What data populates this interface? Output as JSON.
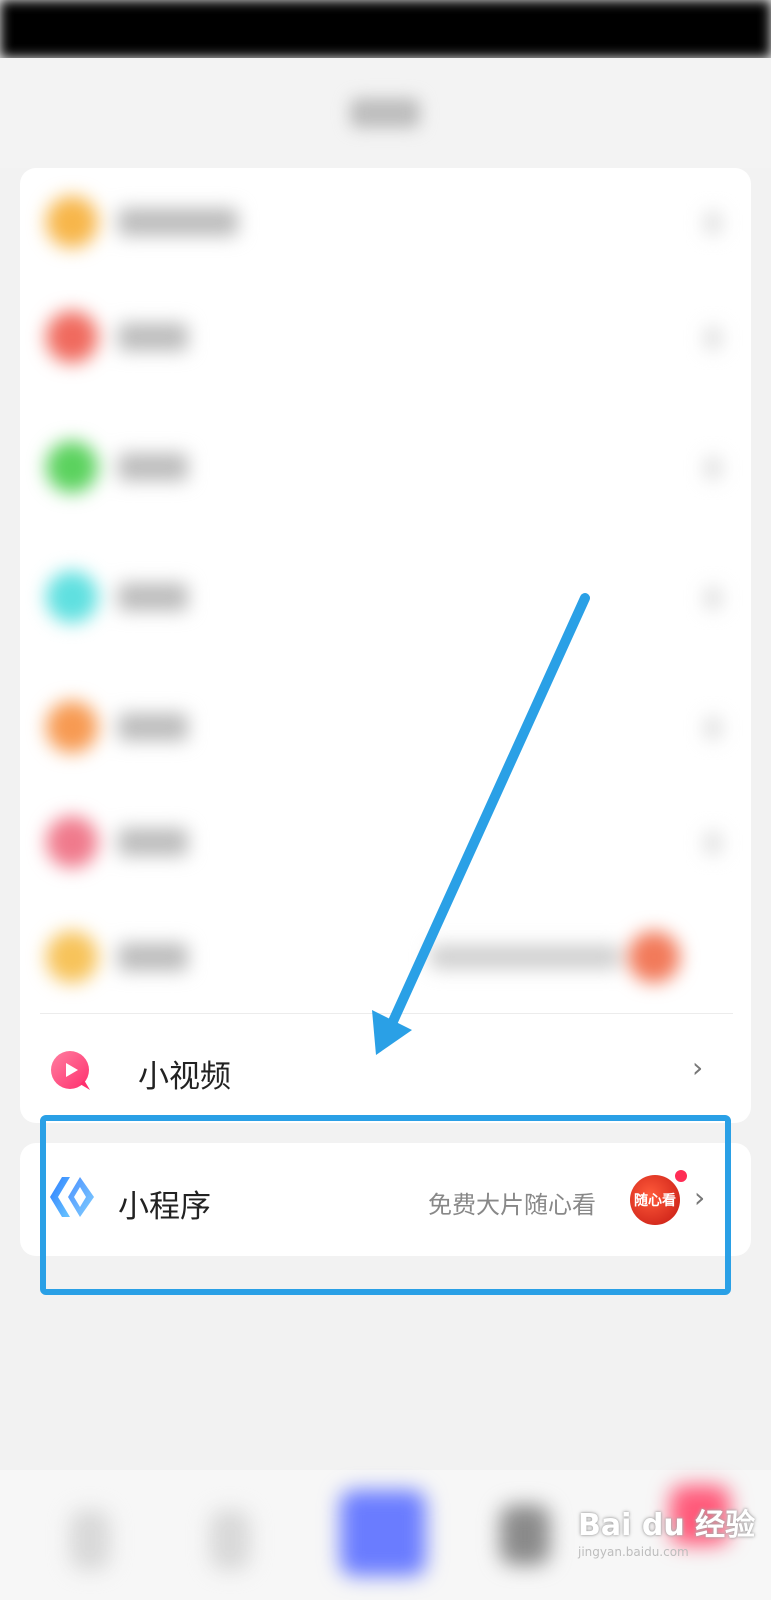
{
  "list": {
    "small_video": {
      "label": "小视频"
    },
    "mini_program": {
      "label": "小程序",
      "subtitle": "免费大片随心看",
      "badge_text": "随心看"
    }
  },
  "blurred_rows": [
    {
      "icon_color": "#f7b64a"
    },
    {
      "icon_color": "#f06a5e"
    },
    {
      "icon_color": "#5bd25e"
    },
    {
      "icon_color": "#5fe0e0"
    },
    {
      "icon_color": "#f79a52"
    },
    {
      "icon_color": "#f07a8c"
    },
    {
      "icon_color": "#f7c35a"
    }
  ],
  "colors": {
    "annotation": "#2aa0e6",
    "chevron": "#777777",
    "subtitle": "#888888"
  },
  "watermark": {
    "text": "Bai du 经验",
    "url": "jingyan.baidu.com"
  }
}
